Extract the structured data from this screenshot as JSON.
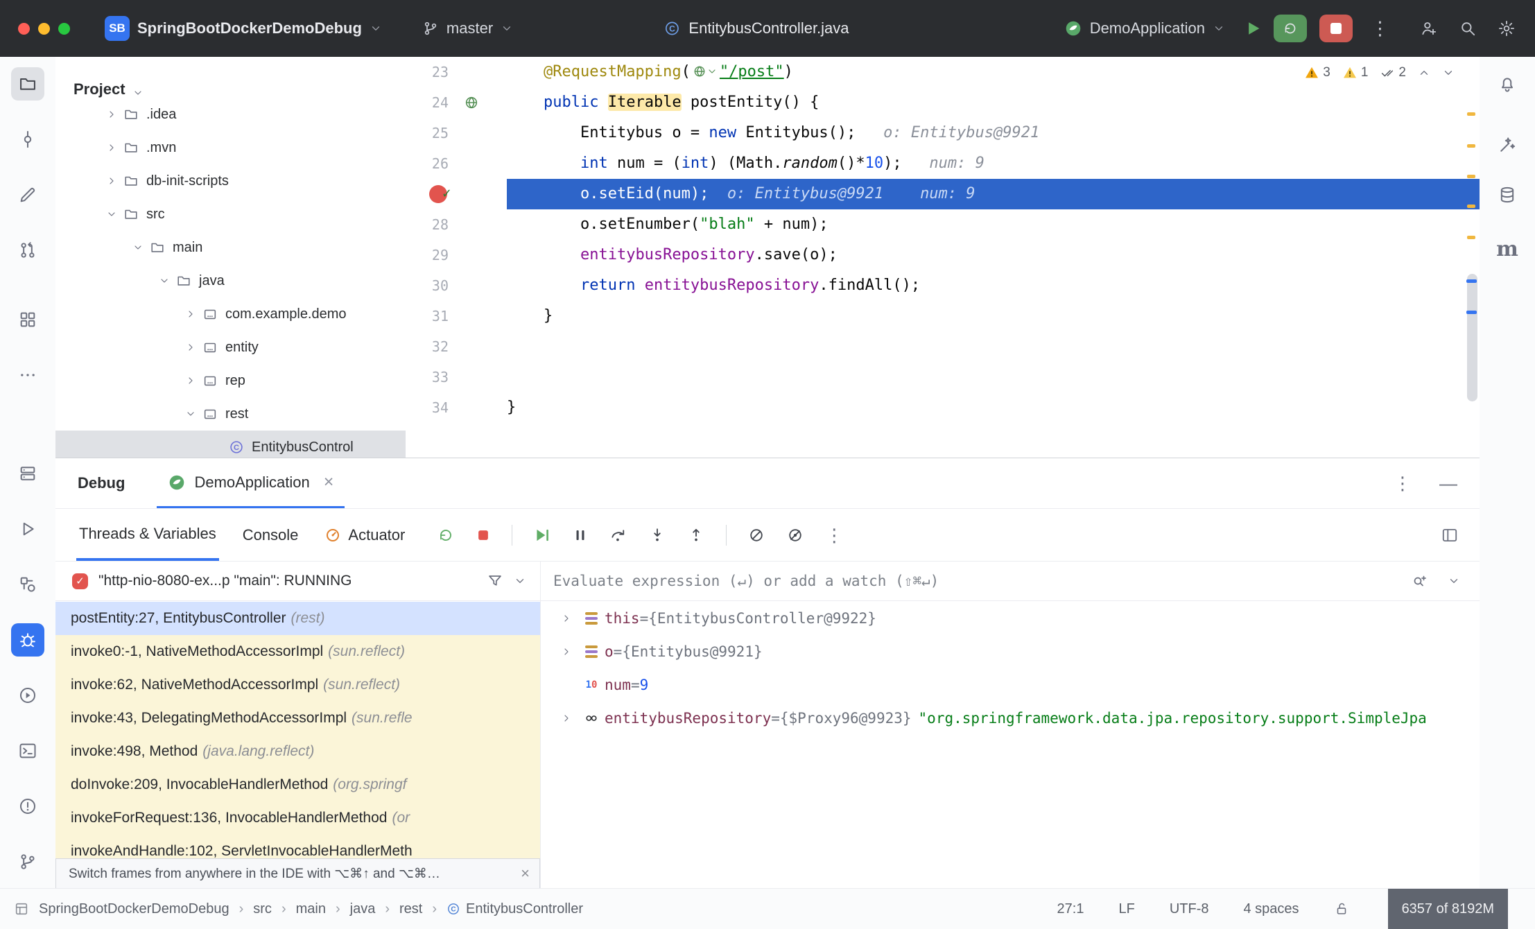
{
  "colors": {
    "accent_blue": "#3574f0",
    "titlebar_bg": "#2b2d30",
    "execution_line_bg": "#2e65c9",
    "breakpoint_red": "#e2544e",
    "keyword_blue": "#0033b3",
    "string_green": "#067d17",
    "field_purple": "#871094",
    "annotation_olive": "#9e880d",
    "warning_orange": "#f2a60d",
    "library_frame_bg": "#fbf5d8",
    "selected_frame_bg": "#d4e2ff",
    "run_green": "#5fad65",
    "stop_red": "#cd5a53"
  },
  "titlebar": {
    "project_badge": "SB",
    "project_name": "SpringBootDockerDemoDebug",
    "branch_name": "master",
    "file_title": "EntitybusController.java",
    "run_config": "DemoApplication"
  },
  "stripes": {
    "left_top": [
      {
        "name": "project",
        "icon": "folder",
        "selected": true
      },
      {
        "name": "commit",
        "icon": "commit"
      },
      {
        "name": "edit",
        "icon": "pencil"
      },
      {
        "name": "pull-requests",
        "icon": "pr"
      },
      {
        "name": "structure",
        "icon": "structure",
        "gap": true
      },
      {
        "name": "more-tool-windows",
        "icon": "more"
      }
    ],
    "left_bottom": [
      {
        "name": "database-server",
        "icon": "server"
      },
      {
        "name": "run",
        "icon": "play-outline"
      },
      {
        "name": "services",
        "icon": "services"
      },
      {
        "name": "debug",
        "icon": "bug",
        "selected": true,
        "accent": true
      },
      {
        "name": "profiler",
        "icon": "profiler"
      },
      {
        "name": "terminal",
        "icon": "terminal"
      },
      {
        "name": "problems",
        "icon": "problems"
      },
      {
        "name": "version-control",
        "icon": "branch"
      }
    ],
    "right": [
      {
        "name": "notifications",
        "icon": "bell"
      },
      {
        "name": "ai-assistant",
        "icon": "wand"
      },
      {
        "name": "database",
        "icon": "db-stack"
      },
      {
        "name": "maven",
        "icon": "maven"
      }
    ]
  },
  "project_panel": {
    "header": "Project",
    "tree": [
      {
        "label": ".idea",
        "icon": "folder",
        "chevron": "right",
        "indent": 0
      },
      {
        "label": ".mvn",
        "icon": "folder",
        "chevron": "right",
        "indent": 0
      },
      {
        "label": "db-init-scripts",
        "icon": "folder",
        "chevron": "right",
        "indent": 0
      },
      {
        "label": "src",
        "icon": "folder",
        "chevron": "down",
        "indent": 0
      },
      {
        "label": "main",
        "icon": "folder",
        "chevron": "down",
        "indent": 1
      },
      {
        "label": "java",
        "icon": "folder",
        "chevron": "down",
        "indent": 2
      },
      {
        "label": "com.example.demo",
        "icon": "package",
        "chevron": "right",
        "indent": 3
      },
      {
        "label": "entity",
        "icon": "package",
        "chevron": "right",
        "indent": 3
      },
      {
        "label": "rep",
        "icon": "package",
        "chevron": "right",
        "indent": 3
      },
      {
        "label": "rest",
        "icon": "package",
        "chevron": "down",
        "indent": 3
      },
      {
        "label": "EntitybusControl",
        "icon": "class",
        "chevron": "none",
        "indent": 4,
        "selected": true
      }
    ]
  },
  "editor": {
    "inspections": {
      "warnings_1": "3",
      "warnings_2": "1",
      "passed": "2"
    },
    "lines": [
      {
        "num": "23",
        "segs": [
          [
            "p",
            "    "
          ],
          [
            "ann",
            "@RequestMapping"
          ],
          [
            "p",
            "("
          ],
          [
            "icon",
            "globe-inlay"
          ],
          [
            "strlink",
            "\"/post\""
          ],
          [
            "p",
            ")"
          ]
        ]
      },
      {
        "num": "24",
        "gutter": "endpoint",
        "segs": [
          [
            "p",
            "    "
          ],
          [
            "kw",
            "public"
          ],
          [
            "p",
            " "
          ],
          [
            "hl",
            "Iterable"
          ],
          [
            "p",
            " postEntity() {"
          ]
        ]
      },
      {
        "num": "25",
        "segs": [
          [
            "p",
            "        Entitybus o = "
          ],
          [
            "kw",
            "new"
          ],
          [
            "p",
            " Entitybus();"
          ],
          [
            "sp",
            "   "
          ],
          [
            "hint",
            "o: Entitybus@9921"
          ]
        ]
      },
      {
        "num": "26",
        "segs": [
          [
            "p",
            "        "
          ],
          [
            "kw",
            "int"
          ],
          [
            "p",
            " num = ("
          ],
          [
            "kw",
            "int"
          ],
          [
            "p",
            ") (Math."
          ],
          [
            "itm",
            "random"
          ],
          [
            "p",
            "()*"
          ],
          [
            "n",
            "10"
          ],
          [
            "p",
            ");"
          ],
          [
            "sp",
            "   "
          ],
          [
            "hint",
            "num: 9"
          ]
        ]
      },
      {
        "num": "27",
        "exec": true,
        "gutter": "breakpoint",
        "segs": [
          [
            "p",
            "        o.setEid(num);"
          ],
          [
            "sp",
            "  "
          ],
          [
            "hint",
            "o: Entitybus@9921"
          ],
          [
            "sp",
            "    "
          ],
          [
            "hint",
            "num: 9"
          ]
        ]
      },
      {
        "num": "28",
        "segs": [
          [
            "p",
            "        o.setEnumber("
          ],
          [
            "str",
            "\"blah\""
          ],
          [
            "p",
            " + num);"
          ]
        ]
      },
      {
        "num": "29",
        "segs": [
          [
            "p",
            "        "
          ],
          [
            "field",
            "entitybusRepository"
          ],
          [
            "p",
            ".save(o);"
          ]
        ]
      },
      {
        "num": "30",
        "segs": [
          [
            "p",
            "        "
          ],
          [
            "kw",
            "return"
          ],
          [
            "p",
            " "
          ],
          [
            "field",
            "entitybusRepository"
          ],
          [
            "p",
            ".findAll();"
          ]
        ]
      },
      {
        "num": "31",
        "segs": [
          [
            "p",
            "    }"
          ]
        ]
      },
      {
        "num": "32",
        "segs": []
      },
      {
        "num": "33",
        "segs": []
      },
      {
        "num": "34",
        "segs": [
          [
            "p",
            "}"
          ]
        ]
      }
    ]
  },
  "debug": {
    "tool_title": "Debug",
    "session_tab": "DemoApplication",
    "tabs": [
      "Threads & Variables",
      "Console",
      "Actuator"
    ],
    "thread_status": "\"http-nio-8080-ex...p \"main\": RUNNING",
    "frames": [
      {
        "text": "postEntity:27, EntitybusController",
        "pkg": "(rest)",
        "selected": true
      },
      {
        "text": "invoke0:-1, NativeMethodAccessorImpl",
        "pkg": "(sun.reflect)",
        "lib": true
      },
      {
        "text": "invoke:62, NativeMethodAccessorImpl",
        "pkg": "(sun.reflect)",
        "lib": true
      },
      {
        "text": "invoke:43, DelegatingMethodAccessorImpl",
        "pkg": "(sun.refle",
        "lib": true
      },
      {
        "text": "invoke:498, Method",
        "pkg": "(java.lang.reflect)",
        "lib": true
      },
      {
        "text": "doInvoke:209, InvocableHandlerMethod",
        "pkg": "(org.springf",
        "lib": true
      },
      {
        "text": "invokeForRequest:136, InvocableHandlerMethod",
        "pkg": "(or",
        "lib": true
      },
      {
        "text": "invokeAndHandle:102, ServletInvocableHandlerMeth",
        "pkg": "",
        "lib": true
      }
    ],
    "frames_hint": "Switch frames from anywhere in the IDE with ⌥⌘↑ and ⌥⌘…",
    "evaluate_placeholder": "Evaluate expression (↵) or add a watch (⇧⌘↵)",
    "variables": [
      {
        "name": "this",
        "value": "{EntitybusController@9922}",
        "icon": "object",
        "expandable": true
      },
      {
        "name": "o",
        "value": "{Entitybus@9921}",
        "icon": "object",
        "expandable": true
      },
      {
        "name": "num",
        "value": "9",
        "icon": "primitive",
        "value_kind": "number",
        "expandable": false
      },
      {
        "name": "entitybusRepository",
        "value": "{$Proxy96@9923}",
        "string_value": "\"org.springframework.data.jpa.repository.support.SimpleJpa",
        "icon": "bean",
        "expandable": true
      }
    ]
  },
  "statusbar": {
    "breadcrumbs": [
      "SpringBootDockerDemoDebug",
      "src",
      "main",
      "java",
      "rest",
      "EntitybusController"
    ],
    "caret": "27:1",
    "line_ending": "LF",
    "encoding": "UTF-8",
    "indent": "4 spaces",
    "memory": "6357 of 8192M"
  }
}
